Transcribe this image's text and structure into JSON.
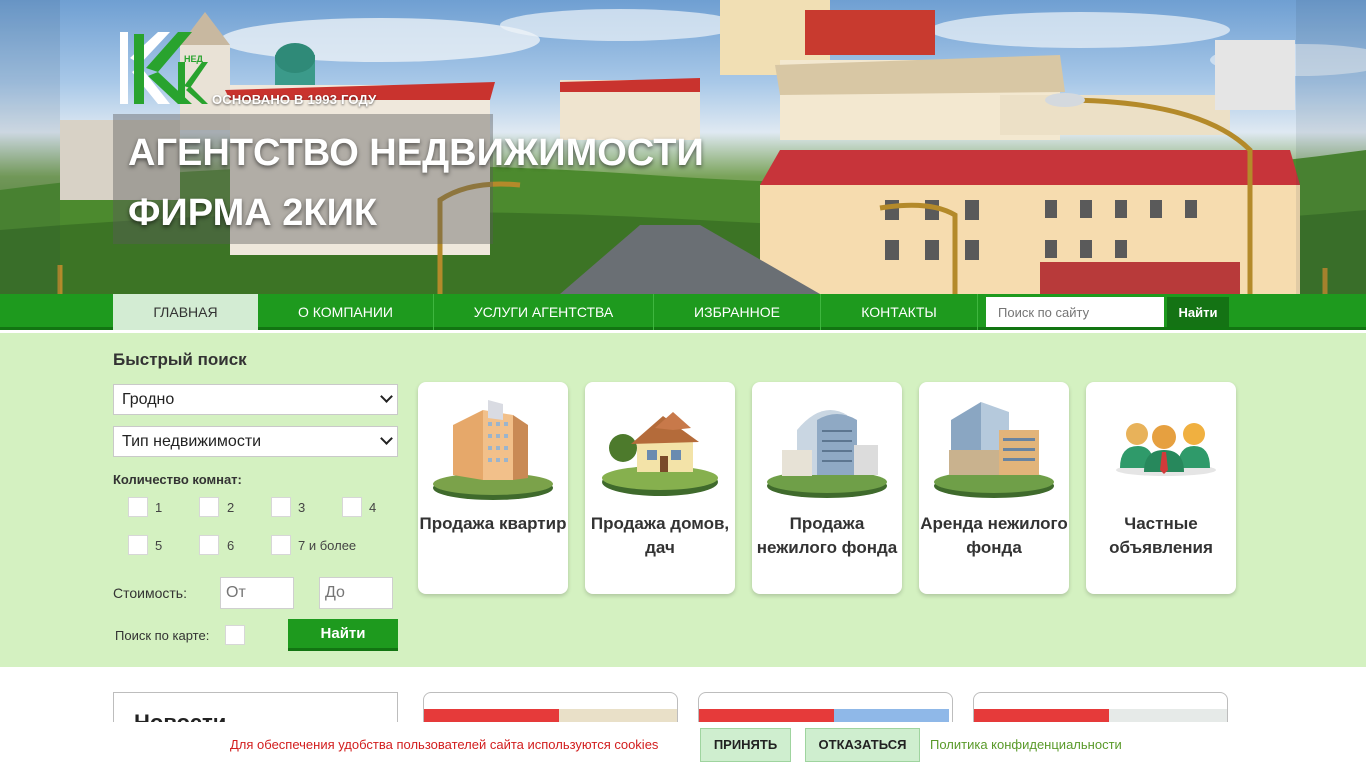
{
  "header": {
    "founded": "ОСНОВАНО В 1993 ГОДУ",
    "headline_line1": "АГЕНТСТВО НЕДВИЖИМОСТИ",
    "headline_line2": "ФИРМА 2КИК",
    "logo_icon": "company-logo-2kik"
  },
  "nav": {
    "items": [
      {
        "label": "ГЛАВНАЯ",
        "active": true
      },
      {
        "label": "О КОМПАНИИ",
        "active": false
      },
      {
        "label": "УСЛУГИ АГЕНТСТВА",
        "active": false
      },
      {
        "label": "ИЗБРАННОЕ",
        "active": false
      },
      {
        "label": "КОНТАКТЫ",
        "active": false
      }
    ],
    "search_placeholder": "Поиск по сайту",
    "search_button": "Найти"
  },
  "quick_search": {
    "title": "Быстрый поиск",
    "city_select": "Гродно",
    "type_select": "Тип недвижимости",
    "rooms_label": "Количество комнат:",
    "rooms": [
      "1",
      "2",
      "3",
      "4",
      "5",
      "6",
      "7 и более"
    ],
    "price_label": "Стоимость:",
    "price_from_placeholder": "От",
    "price_to_placeholder": "До",
    "map_label": "Поиск по карте:",
    "find_button": "Найти"
  },
  "categories": [
    {
      "label": "Продажа квартир",
      "icon": "apartment-building-icon"
    },
    {
      "label": "Продажа домов, дач",
      "icon": "house-icon"
    },
    {
      "label": "Продажа нежилого фонда",
      "icon": "office-building-icon"
    },
    {
      "label": "Аренда нежилого фонда",
      "icon": "business-center-icon"
    },
    {
      "label": "Частные объявления",
      "icon": "people-icon"
    }
  ],
  "news": {
    "title": "Новости"
  },
  "cookie": {
    "text": "Для обеспечения удобства пользователей сайта используются cookies",
    "accept": "ПРИНЯТЬ",
    "decline": "ОТКАЗАТЬСЯ",
    "policy": "Политика конфиденциальности"
  },
  "colors": {
    "nav_green": "#1e9a1e",
    "search_bg": "#d4f1c1",
    "cookie_red": "#d21e1e",
    "accent_red": "#e63a3a"
  }
}
